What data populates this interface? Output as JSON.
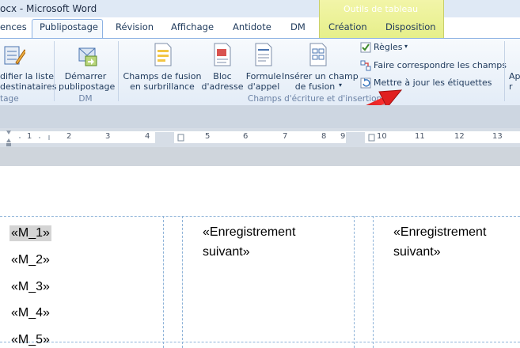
{
  "window": {
    "title": "ocx - Microsoft Word"
  },
  "contextual": {
    "title": "Outils de tableau"
  },
  "tabs": [
    "ences",
    "Publipostage",
    "Révision",
    "Affichage",
    "Antidote",
    "DM",
    "Création",
    "Disposition"
  ],
  "ribbon": {
    "group1": {
      "btn_line1": "difier la liste",
      "btn_line2": "destinataires",
      "label": "tage"
    },
    "group2": {
      "btn_line1": "Démarrer",
      "btn_line2": "publipostage",
      "label": "DM"
    },
    "group3": {
      "b1_line1": "Champs de fusion",
      "b1_line2": "en surbrillance",
      "b2_line1": "Bloc",
      "b2_line2": "d'adresse",
      "b3_line1": "Formule",
      "b3_line2": "d'appel",
      "b4_line1": "Insérer un champ",
      "b4_line2": "de fusion",
      "small1": "Règles",
      "small2": "Faire correspondre les champs",
      "small3": "Mettre à jour les étiquettes",
      "label": "Champs d'écriture et d'insertion"
    },
    "right_cut": {
      "line1": "Ap",
      "line2": "r"
    }
  },
  "ruler": {
    "numbers": [
      "1",
      "1",
      "2",
      "3",
      "4",
      "5",
      "6",
      "7",
      "8",
      "9",
      "10",
      "11",
      "12",
      "13"
    ]
  },
  "document": {
    "cell1": [
      "«M_1»",
      "«M_2»",
      "«M_3»",
      "«M_4»",
      "«M_5»"
    ],
    "cell2": {
      "line1": "«Enregistrement",
      "line2": "suivant»"
    },
    "cell3": {
      "line1": "«Enregistrement",
      "line2": "suivant»"
    }
  },
  "colors": {
    "arrow": "#e02020",
    "accent": "#1e395b",
    "contextual": "#e6ef8a"
  }
}
